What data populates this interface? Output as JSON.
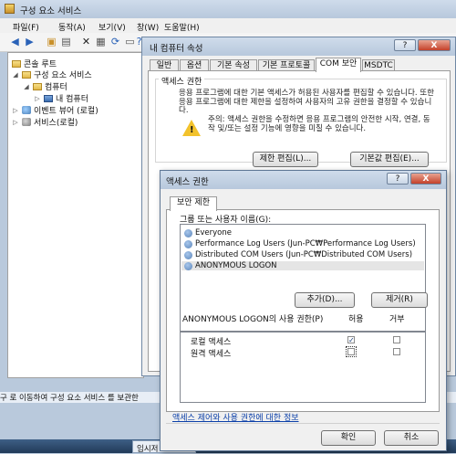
{
  "main_window": {
    "title": "구성 요소 서비스",
    "menu": [
      "파일(F)",
      "동작(A)",
      "보기(V)",
      "창(W)",
      "도움말(H)"
    ],
    "toolbar_icons": [
      "back-icon",
      "forward-icon",
      "up-folder-icon",
      "show-tree-icon",
      "delete-icon",
      "properties-icon",
      "refresh-icon",
      "export-icon",
      "help-icon"
    ],
    "tree": [
      {
        "label": "콘솔 루트",
        "icon": "folder-icon"
      },
      {
        "label": "구성 요소 서비스",
        "icon": "folder-icon"
      },
      {
        "label": "컴퓨터",
        "icon": "folder-icon"
      },
      {
        "label": "내 컴퓨터",
        "icon": "computer-icon"
      },
      {
        "label": "이벤트 뷰어 (로컬)",
        "icon": "event-viewer-icon"
      },
      {
        "label": "서비스(로컬)",
        "icon": "services-icon"
      }
    ],
    "status_text": "구 로 이동하여 구성 요소 서비스 를 보관한",
    "taskbar_item": "임시저"
  },
  "properties_dialog": {
    "title": "내 컴퓨터 속성",
    "help_btn": "?",
    "close_btn": "X",
    "tabs": [
      "일반",
      "옵션",
      "기본 속성",
      "기본 프로토콜",
      "COM 보안",
      "MSDTC"
    ],
    "active_tab": "COM 보안",
    "access_section_title": "액세스 권한",
    "access_description": "응용 프로그램에 대한 기본 액세스가 허용된 사용자를 편집할 수 있습니다. 또한 응용 프로그램에 대한 제한을 설정하여 사용자의 고유 권한을 결정할 수 있습니다.",
    "warning_text": "주의: 액세스 권한을 수정하면 응용 프로그램의 안전한 시작, 연결, 동작 및/또는 설정 기능에 영향을 미칠 수 있습니다.",
    "edit_limits_btn": "제한 편집(L)...",
    "edit_default_btn": "기본값 편집(E)..."
  },
  "access_dialog": {
    "title": "액세스 권한",
    "help_btn": "?",
    "close_btn": "X",
    "tab": "보안 제한",
    "group_label": "그룹 또는 사용자 이름(G):",
    "users": [
      "Everyone",
      "Performance Log Users (Jun-PC₩Performance Log Users)",
      "Distributed COM Users (Jun-PC₩Distributed COM Users)",
      "ANONYMOUS LOGON"
    ],
    "selected_user": "ANONYMOUS LOGON",
    "add_btn": "추가(D)...",
    "remove_btn": "제거(R)",
    "perm_label": "ANONYMOUS LOGON의 사용 권한(P)",
    "allow_col": "허용",
    "deny_col": "거부",
    "permissions": [
      {
        "name": "로컬 액세스",
        "allow": true,
        "deny": false
      },
      {
        "name": "원격 액세스",
        "allow": false,
        "deny": false
      }
    ],
    "help_link": "액세스 제어와 사용 권한에 대한 정보",
    "ok_btn": "확인",
    "cancel_btn": "취소"
  }
}
